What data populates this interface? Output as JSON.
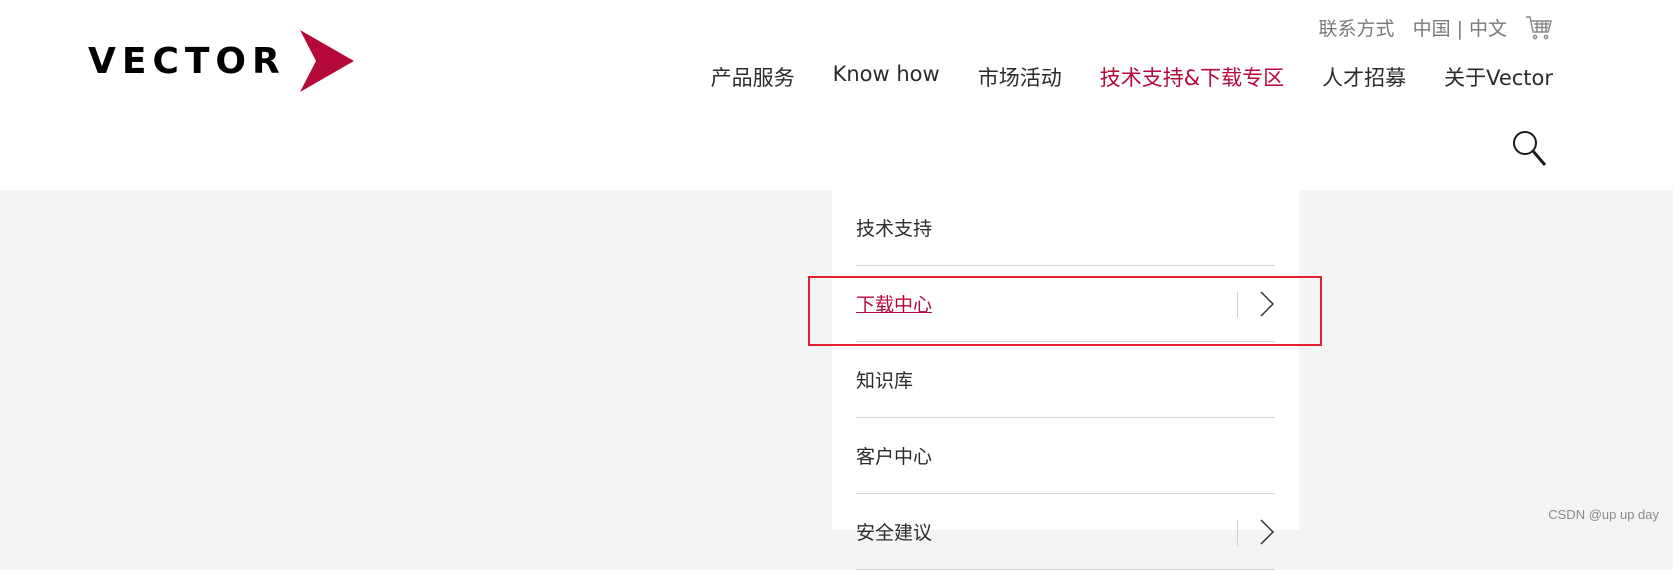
{
  "header": {
    "logo_text": "VECTOR",
    "utility": {
      "contact": "联系方式",
      "lang_region": "中国",
      "lang_separator": "|",
      "lang_language": "中文"
    },
    "nav": [
      {
        "label": "产品服务",
        "active": false
      },
      {
        "label": "Know how",
        "active": false
      },
      {
        "label": "市场活动",
        "active": false
      },
      {
        "label": "技术支持&下载专区",
        "active": true
      },
      {
        "label": "人才招募",
        "active": false
      },
      {
        "label": "关于Vector",
        "active": false
      }
    ]
  },
  "dropdown": {
    "items": [
      {
        "label": "技术支持",
        "has_submenu": false
      },
      {
        "label": "下载中心",
        "has_submenu": true,
        "active": true
      },
      {
        "label": "知识库",
        "has_submenu": false
      },
      {
        "label": "客户中心",
        "has_submenu": false
      },
      {
        "label": "安全建议",
        "has_submenu": true
      }
    ]
  },
  "watermark": "CSDN @up up day",
  "colors": {
    "brand": "#b5093a",
    "highlight_box": "#e3202c",
    "page_bg": "#f3f4f6"
  },
  "icons": [
    "vector-logo-chevron-icon",
    "cart-icon",
    "search-icon",
    "chevron-right-icon"
  ]
}
